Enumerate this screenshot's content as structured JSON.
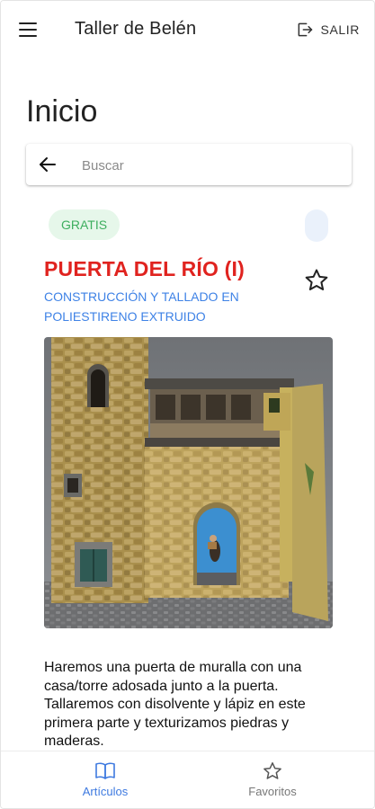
{
  "header": {
    "title": "Taller de Belén",
    "logout_label": "SALIR",
    "menu_icon": "hamburger-menu-icon",
    "logout_icon": "logout-icon"
  },
  "page": {
    "title": "Inicio"
  },
  "search": {
    "placeholder": "Buscar",
    "value": "",
    "back_icon": "arrow-left-icon"
  },
  "article": {
    "badge": "GRATIS",
    "title": "PUERTA DEL RÍO (I)",
    "subtitle": "CONSTRUCCIÓN Y TALLADO EN POLIESTIRENO EXTRUIDO",
    "favorite_icon": "star-outline-icon",
    "description": "Haremos una puerta de muralla con una casa/torre adosada junto a la puerta. Tallaremos con disolvente y lápiz en este primera parte y texturizamos piedras y maderas."
  },
  "bottom_nav": {
    "items": [
      {
        "label": "Artículos",
        "icon": "book-icon",
        "active": true
      },
      {
        "label": "Favoritos",
        "icon": "star-outline-icon",
        "active": false
      }
    ]
  },
  "colors": {
    "title_red": "#e0231f",
    "subtitle_blue": "#3e82e6",
    "badge_green": "#3dae5e",
    "badge_bg": "#e6f7ea",
    "nav_active": "#3e7ae0"
  }
}
